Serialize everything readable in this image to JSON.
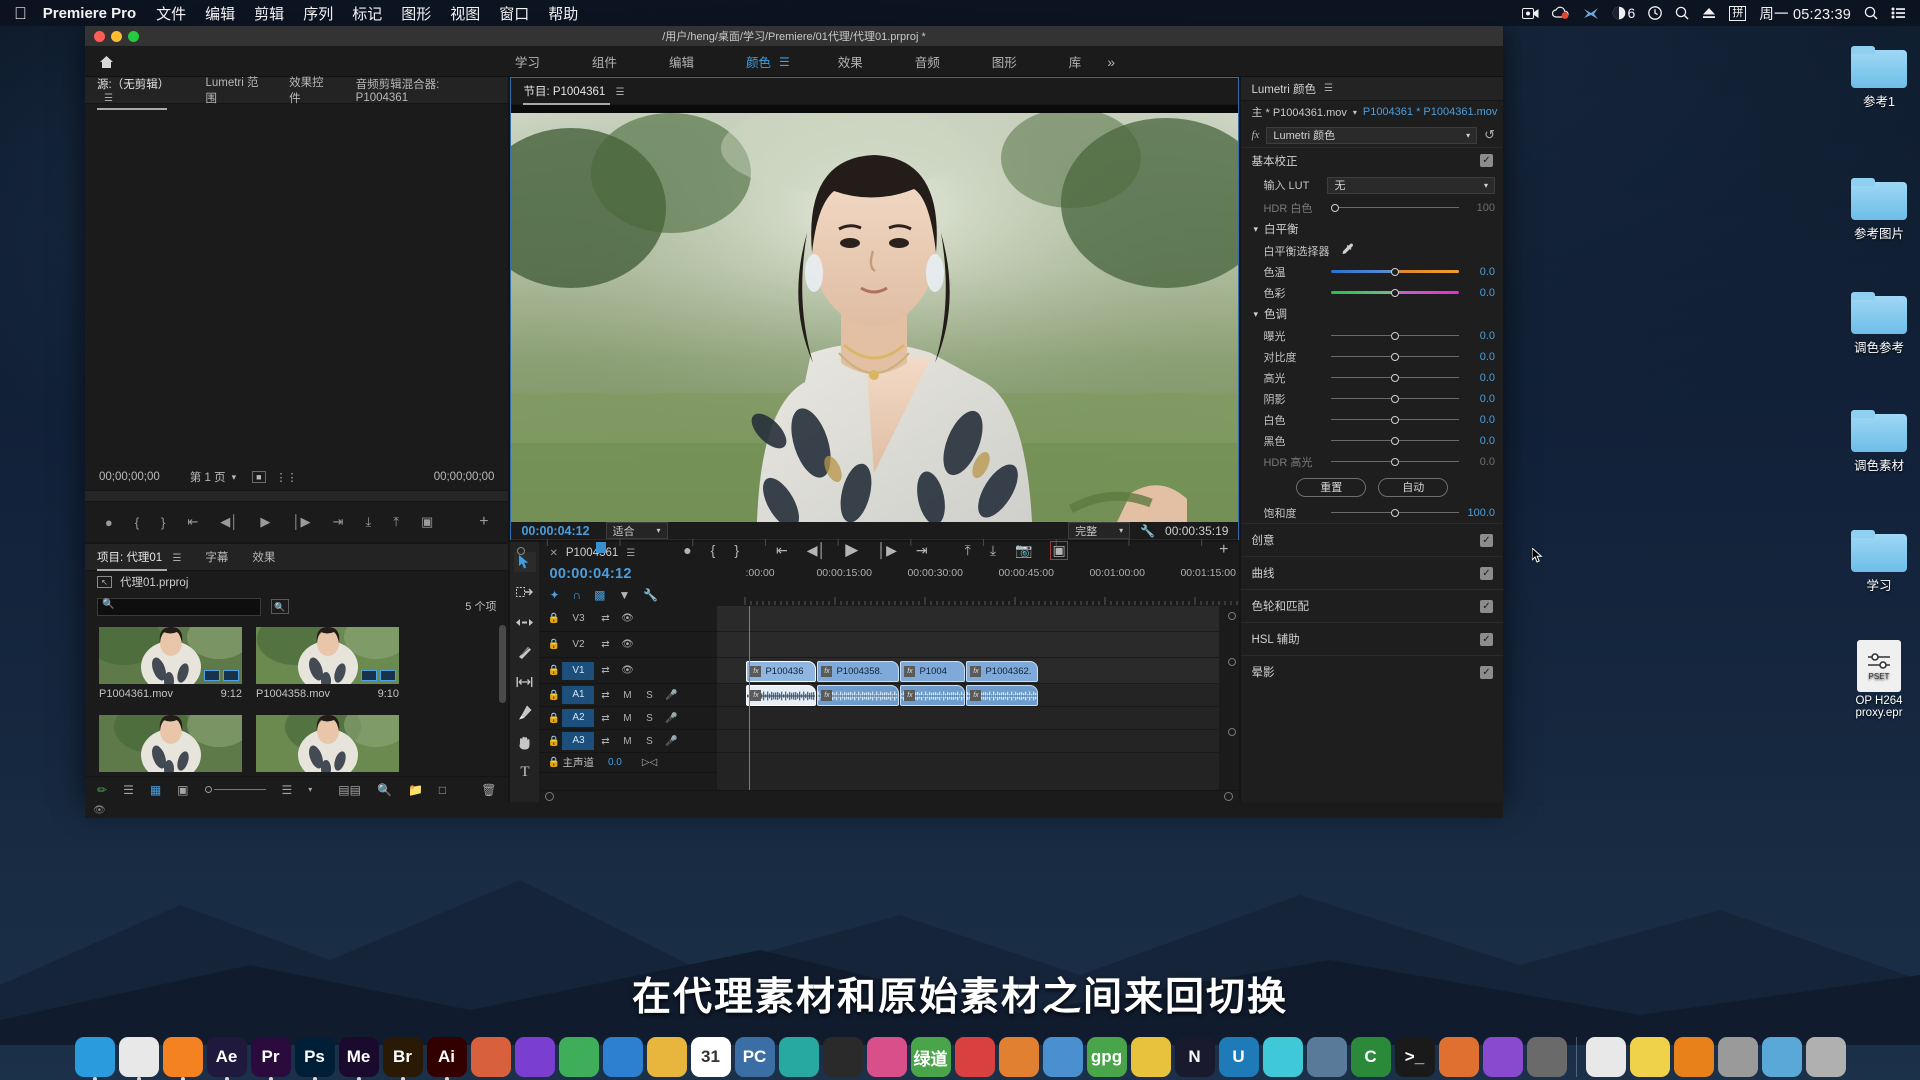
{
  "menubar": {
    "apple_icon": "apple-logo",
    "app_name": "Premiere Pro",
    "items": [
      "文件",
      "编辑",
      "剪辑",
      "序列",
      "标记",
      "图形",
      "视图",
      "窗口",
      "帮助"
    ],
    "status_icons": [
      "screen-record-icon",
      "cloud-record-icon",
      "wechat-icon",
      "clock-badge-icon",
      "time-machine-icon",
      "spotlight-search-icon",
      "eject-icon",
      "input-method-icon"
    ],
    "battery_count": "6",
    "input_method": "拼",
    "clock": "周一 05:23:39",
    "search_icon": "search-icon",
    "control_center_icon": "control-center-icon"
  },
  "desktop": {
    "icons": [
      {
        "label": "参考1",
        "type": "folder"
      },
      {
        "label": "参考图片",
        "type": "folder"
      },
      {
        "label": "调色参考",
        "type": "folder"
      },
      {
        "label": "调色素材",
        "type": "folder"
      },
      {
        "label": "学习",
        "type": "folder"
      },
      {
        "label": "OP H264 proxy.epr",
        "type": "preset",
        "badge": "PSET"
      }
    ]
  },
  "window": {
    "title": "/用户/heng/桌面/学习/Premiere/01代理/代理01.prproj *",
    "home_icon": "home-icon"
  },
  "workspace": {
    "tabs": [
      {
        "label": "学习",
        "active": false
      },
      {
        "label": "组件",
        "active": false
      },
      {
        "label": "编辑",
        "active": false
      },
      {
        "label": "颜色",
        "active": true
      },
      {
        "label": "效果",
        "active": false
      },
      {
        "label": "音频",
        "active": false
      },
      {
        "label": "图形",
        "active": false
      },
      {
        "label": "库",
        "active": false
      }
    ],
    "overflow": "»"
  },
  "source_panel": {
    "tabs": [
      {
        "label": "源:（无剪辑）",
        "active": true,
        "has_menu": true
      },
      {
        "label": "Lumetri 范围",
        "active": false
      },
      {
        "label": "效果控件",
        "active": false
      },
      {
        "label": "音频剪辑混合器: P1004361",
        "active": false
      }
    ],
    "timecode_left": "00;00;00;00",
    "page_label": "第 1 页",
    "timecode_right": "00;00;00;00",
    "buttons": [
      "marker-icon",
      "mark-in-icon",
      "mark-out-icon",
      "goto-in-icon",
      "step-back-icon",
      "play-icon",
      "step-forward-icon",
      "goto-out-icon",
      "insert-icon",
      "overwrite-icon",
      "export-frame-icon"
    ],
    "plus_icon": "plus-icon"
  },
  "program_panel": {
    "tab_label": "节目: P1004361",
    "menu_icon": "panel-menu-icon",
    "timecode_current": "00:00:04:12",
    "fit_label": "适合",
    "quality_label": "完整",
    "wrench_icon": "settings-wrench-icon",
    "timecode_duration": "00:00:35:19",
    "buttons": [
      "add-marker-icon",
      "mark-in-icon",
      "mark-out-icon",
      "goto-in-icon",
      "step-back-icon",
      "play-icon",
      "step-forward-icon",
      "goto-out-icon",
      "lift-icon",
      "extract-icon",
      "export-frame-icon",
      "comparison-view-icon"
    ],
    "plus_icon": "plus-icon"
  },
  "project_panel": {
    "tabs": [
      {
        "label": "项目: 代理01",
        "active": true,
        "has_menu": true
      },
      {
        "label": "字幕",
        "active": false
      },
      {
        "label": "效果",
        "active": false
      }
    ],
    "project_file": "代理01.prproj",
    "search_placeholder": "",
    "item_count": "5 个项",
    "items": [
      {
        "name": "P1004361.mov",
        "duration": "9:12"
      },
      {
        "name": "P1004358.mov",
        "duration": "9:10"
      },
      {
        "name": "",
        "duration": ""
      },
      {
        "name": "",
        "duration": ""
      }
    ],
    "footer_icons": [
      "new-bin-icon",
      "list-view-icon",
      "icon-view-icon",
      "freeform-view-icon",
      "zoom-slider-icon",
      "sort-icon",
      "sort-chevron-icon",
      "automate-icon",
      "find-icon",
      "new-bin-folder-icon",
      "new-item-icon",
      "delete-icon"
    ]
  },
  "timeline": {
    "tab_label": "P1004361",
    "close_icon": "close-icon",
    "menu_icon": "panel-menu-icon",
    "timecode": "00:00:04:12",
    "tool_icons": [
      "snap-linked-selection-icon",
      "magnet-snap-icon",
      "ripple-sequence-markers-icon",
      "add-marker-icon",
      "timeline-settings-icon"
    ],
    "ruler_labels": [
      ":00:00",
      "00:00:15:00",
      "00:00:30:00",
      "00:00:45:00",
      "00:01:00:00",
      "00:01:15:00"
    ],
    "tracks": [
      {
        "name": "V3",
        "type": "video",
        "targeted": false
      },
      {
        "name": "V2",
        "type": "video",
        "targeted": false
      },
      {
        "name": "V1",
        "type": "video",
        "targeted": true
      },
      {
        "name": "A1",
        "type": "audio",
        "targeted": true
      },
      {
        "name": "A2",
        "type": "audio",
        "targeted": true
      },
      {
        "name": "A3",
        "type": "audio",
        "targeted": true
      }
    ],
    "master_track": {
      "label": "主声道",
      "value": "0.0"
    },
    "clips_video": [
      {
        "label": "P100436",
        "selected": true
      },
      {
        "label": "P1004358.",
        "selected": false
      },
      {
        "label": "P1004",
        "selected": false
      },
      {
        "label": "P1004362.",
        "selected": false
      }
    ],
    "audio_labels": [
      "M",
      "S"
    ],
    "mic_icon": "microphone-icon",
    "lock_icon": "lock-icon",
    "sync_icon": "sync-lock-icon",
    "eye_icon": "track-output-eye-icon"
  },
  "toolbox": {
    "tools": [
      {
        "name": "selection-tool",
        "glyph": "selection-arrow-icon",
        "active": true
      },
      {
        "name": "track-select-forward-tool",
        "glyph": "track-select-icon",
        "active": false
      },
      {
        "name": "ripple-edit-tool",
        "glyph": "ripple-edit-icon",
        "active": false
      },
      {
        "name": "razor-tool",
        "glyph": "razor-icon",
        "active": false
      },
      {
        "name": "slip-tool",
        "glyph": "slip-icon",
        "active": false
      },
      {
        "name": "pen-tool",
        "glyph": "pen-icon",
        "active": false
      },
      {
        "name": "hand-tool",
        "glyph": "hand-icon",
        "active": false
      },
      {
        "name": "type-tool",
        "glyph": "type-T-icon",
        "active": false
      }
    ]
  },
  "lumetri": {
    "panel_title": "Lumetri 颜色",
    "menu_icon": "panel-menu-icon",
    "master_label": "主 * P1004361.mov",
    "clip_label": "P1004361 * P1004361.mov",
    "fx_icon": "fx-icon",
    "effect_name": "Lumetri 颜色",
    "reset_icon": "reset-icon",
    "basic": {
      "title": "基本校正",
      "checked": true,
      "lut": {
        "label": "输入 LUT",
        "value": "无"
      },
      "hdr_white": {
        "label": "HDR 白色",
        "value": "100",
        "knob": 0,
        "dim": true
      },
      "white_balance": {
        "title": "白平衡",
        "picker_label": "白平衡选择器",
        "picker_icon": "eyedropper-icon",
        "temperature": {
          "label": "色温",
          "value": "0.0",
          "knob": 50
        },
        "tint": {
          "label": "色彩",
          "value": "0.0",
          "knob": 50
        }
      },
      "tone": {
        "title": "色调",
        "sliders": [
          {
            "label": "曝光",
            "value": "0.0",
            "knob": 50,
            "dim": false
          },
          {
            "label": "对比度",
            "value": "0.0",
            "knob": 50,
            "dim": false
          },
          {
            "label": "高光",
            "value": "0.0",
            "knob": 50,
            "dim": false
          },
          {
            "label": "阴影",
            "value": "0.0",
            "knob": 50,
            "dim": false
          },
          {
            "label": "白色",
            "value": "0.0",
            "knob": 50,
            "dim": false
          },
          {
            "label": "黑色",
            "value": "0.0",
            "knob": 50,
            "dim": false
          },
          {
            "label": "HDR 高光",
            "value": "0.0",
            "knob": 50,
            "dim": true
          }
        ],
        "reset_button": "重置",
        "auto_button": "自动"
      },
      "saturation": {
        "label": "饱和度",
        "value": "100.0",
        "knob": 50
      }
    },
    "sections": [
      {
        "title": "创意",
        "checked": true
      },
      {
        "title": "曲线",
        "checked": true
      },
      {
        "title": "色轮和匹配",
        "checked": true
      },
      {
        "title": "HSL 辅助",
        "checked": true
      },
      {
        "title": "晕影",
        "checked": true
      }
    ]
  },
  "subtitle": {
    "text": "在代理素材和原始素材之间来回切换"
  },
  "dock": {
    "items": [
      {
        "name": "finder",
        "label": "",
        "color": "#2a9bdd"
      },
      {
        "name": "chrome",
        "label": "",
        "color": "#e8e8e8"
      },
      {
        "name": "firefox",
        "label": "",
        "color": "#f58220"
      },
      {
        "name": "after-effects",
        "label": "Ae",
        "color": "#1f1a3d"
      },
      {
        "name": "premiere-pro",
        "label": "Pr",
        "color": "#2b0a3d"
      },
      {
        "name": "photoshop",
        "label": "Ps",
        "color": "#001e36"
      },
      {
        "name": "media-encoder",
        "label": "Me",
        "color": "#1a0a2e"
      },
      {
        "name": "bridge",
        "label": "Br",
        "color": "#2a1a05"
      },
      {
        "name": "illustrator",
        "label": "Ai",
        "color": "#330000"
      },
      {
        "name": "app-colorful-1",
        "label": "",
        "color": "#d8603c"
      },
      {
        "name": "app-purple",
        "label": "",
        "color": "#7a3fd0"
      },
      {
        "name": "app-green",
        "label": "",
        "color": "#3fae5a"
      },
      {
        "name": "app-blue-files",
        "label": "",
        "color": "#2d7fd0"
      },
      {
        "name": "app-yellow",
        "label": "",
        "color": "#e8b63c"
      },
      {
        "name": "calendar",
        "label": "31",
        "color": "#ffffff"
      },
      {
        "name": "pc-app",
        "label": "PC",
        "color": "#3a6ea5"
      },
      {
        "name": "app-teal",
        "label": "",
        "color": "#27a8a0"
      },
      {
        "name": "app-terminal-dark",
        "label": "",
        "color": "#2a2a2a"
      },
      {
        "name": "app-pink",
        "label": "",
        "color": "#d84f8a"
      },
      {
        "name": "green-app",
        "label": "绿道",
        "color": "#4aa54a"
      },
      {
        "name": "app-red-bird",
        "label": "",
        "color": "#d94040"
      },
      {
        "name": "app-orange-chart",
        "label": "",
        "color": "#e08030"
      },
      {
        "name": "app-multicolor",
        "label": "",
        "color": "#4a90d0"
      },
      {
        "name": "app-gpg",
        "label": "gpg",
        "color": "#4aa54a"
      },
      {
        "name": "app-yellow-note",
        "label": "",
        "color": "#e8c23c"
      },
      {
        "name": "app-dark-n",
        "label": "N",
        "color": "#1a1a2e"
      },
      {
        "name": "app-u",
        "label": "U",
        "color": "#1f7ab8"
      },
      {
        "name": "app-cyan",
        "label": "",
        "color": "#3fc8d8"
      },
      {
        "name": "app-bluegrey",
        "label": "",
        "color": "#5a7a9a"
      },
      {
        "name": "app-green-c",
        "label": "C",
        "color": "#2a8a3a"
      },
      {
        "name": "terminal",
        "label": ">_",
        "color": "#1a1a1a"
      },
      {
        "name": "app-orange-round",
        "label": "",
        "color": "#e07030"
      },
      {
        "name": "app-colorwheel",
        "label": "",
        "color": "#8a4ad0"
      },
      {
        "name": "app-settings-gear",
        "label": "",
        "color": "#6a6a6a"
      },
      {
        "name": "separator",
        "label": "",
        "color": ""
      },
      {
        "name": "app-preview-doc",
        "label": "",
        "color": "#e8e8e8"
      },
      {
        "name": "app-note-yellow",
        "label": "",
        "color": "#f0d24a"
      },
      {
        "name": "vlc",
        "label": "",
        "color": "#e8811a"
      },
      {
        "name": "app-photos-grey",
        "label": "",
        "color": "#9a9a9a"
      },
      {
        "name": "downloads-folder",
        "label": "",
        "color": "#5aa8d8"
      },
      {
        "name": "trash",
        "label": "",
        "color": "#b0b0b0"
      }
    ]
  }
}
